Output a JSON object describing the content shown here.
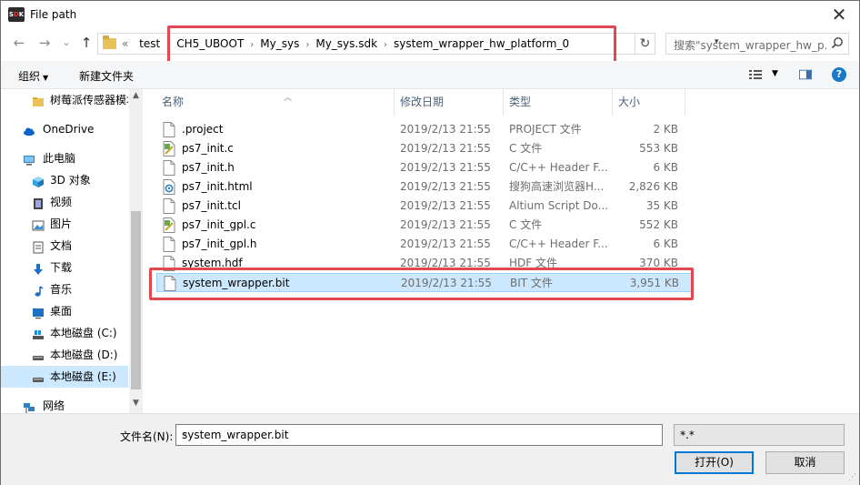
{
  "window": {
    "title": "File path",
    "app_icon": {
      "prefix": "S",
      "highlight": "D",
      "suffix": "K"
    },
    "close_glyph": "✕"
  },
  "nav": {
    "back_glyph": "←",
    "forward_glyph": "→",
    "recent_glyph": "⌄",
    "up_glyph": "↑",
    "crumb_overflow": "«",
    "breadcrumbs": [
      "test",
      "CH5_UBOOT",
      "My_sys",
      "My_sys.sdk",
      "system_wrapper_hw_platform_0"
    ],
    "crumb_sep": "›",
    "address_dropdown_glyph": "▾",
    "refresh_glyph": "↻",
    "search_placeholder": "搜索\"system_wrapper_hw_p..."
  },
  "toolbar": {
    "organize_label": "组织",
    "caret": "▼",
    "new_folder_label": "新建文件夹",
    "help_glyph": "?"
  },
  "sidebar": {
    "items": [
      {
        "label": "树莓派传感器模块",
        "icon": "folder-icon",
        "top": false,
        "selected": false
      },
      {
        "label": "OneDrive",
        "icon": "cloud-icon",
        "top": true,
        "selected": false
      },
      {
        "label": "此电脑",
        "icon": "computer-icon",
        "top": true,
        "selected": false
      },
      {
        "label": "3D 对象",
        "icon": "cube-icon",
        "top": false,
        "selected": false
      },
      {
        "label": "视频",
        "icon": "video-icon",
        "top": false,
        "selected": false
      },
      {
        "label": "图片",
        "icon": "picture-icon",
        "top": false,
        "selected": false
      },
      {
        "label": "文档",
        "icon": "document-icon",
        "top": false,
        "selected": false
      },
      {
        "label": "下载",
        "icon": "download-icon",
        "top": false,
        "selected": false
      },
      {
        "label": "音乐",
        "icon": "music-icon",
        "top": false,
        "selected": false
      },
      {
        "label": "桌面",
        "icon": "desktop-icon",
        "top": false,
        "selected": false
      },
      {
        "label": "本地磁盘 (C:)",
        "icon": "windows-drive-icon",
        "top": false,
        "selected": false
      },
      {
        "label": "本地磁盘 (D:)",
        "icon": "drive-icon",
        "top": false,
        "selected": false
      },
      {
        "label": "本地磁盘 (E:)",
        "icon": "drive-icon",
        "top": false,
        "selected": true
      },
      {
        "label": "网络",
        "icon": "network-icon",
        "top": true,
        "selected": false
      }
    ],
    "scroll_up_glyph": "▲",
    "scroll_down_glyph": "▼"
  },
  "columns": {
    "name": "名称",
    "date": "修改日期",
    "type": "类型",
    "size": "大小",
    "sort_glyph": "︿"
  },
  "files": [
    {
      "name": ".project",
      "date": "2019/2/13 21:55",
      "type": "PROJECT 文件",
      "size": "2 KB",
      "icon": "blank-file-icon",
      "selected": false
    },
    {
      "name": "ps7_init.c",
      "date": "2019/2/13 21:55",
      "type": "C 文件",
      "size": "553 KB",
      "icon": "c-file-icon",
      "selected": false
    },
    {
      "name": "ps7_init.h",
      "date": "2019/2/13 21:55",
      "type": "C/C++ Header F...",
      "size": "6 KB",
      "icon": "blank-file-icon",
      "selected": false
    },
    {
      "name": "ps7_init.html",
      "date": "2019/2/13 21:55",
      "type": "搜狗高速浏览器H...",
      "size": "2,826 KB",
      "icon": "html-file-icon",
      "selected": false
    },
    {
      "name": "ps7_init.tcl",
      "date": "2019/2/13 21:55",
      "type": "Altium Script Do...",
      "size": "35 KB",
      "icon": "blank-file-icon",
      "selected": false
    },
    {
      "name": "ps7_init_gpl.c",
      "date": "2019/2/13 21:55",
      "type": "C 文件",
      "size": "552 KB",
      "icon": "c-file-icon",
      "selected": false
    },
    {
      "name": "ps7_init_gpl.h",
      "date": "2019/2/13 21:55",
      "type": "C/C++ Header F...",
      "size": "6 KB",
      "icon": "blank-file-icon",
      "selected": false
    },
    {
      "name": "system.hdf",
      "date": "2019/2/13 21:55",
      "type": "HDF 文件",
      "size": "370 KB",
      "icon": "blank-file-icon",
      "selected": false
    },
    {
      "name": "system_wrapper.bit",
      "date": "2019/2/13 21:55",
      "type": "BIT 文件",
      "size": "3,951 KB",
      "icon": "blank-file-icon",
      "selected": true
    }
  ],
  "bottom": {
    "filename_label": "文件名(N):",
    "filename_value": "system_wrapper.bit",
    "dropdown_glyph": "⌄",
    "filter_value": "*.*",
    "open_label": "打开(O)",
    "cancel_label": "取消"
  },
  "colors": {
    "highlight": "#e34850",
    "selection": "#cce8ff",
    "accent": "#0078d7"
  }
}
